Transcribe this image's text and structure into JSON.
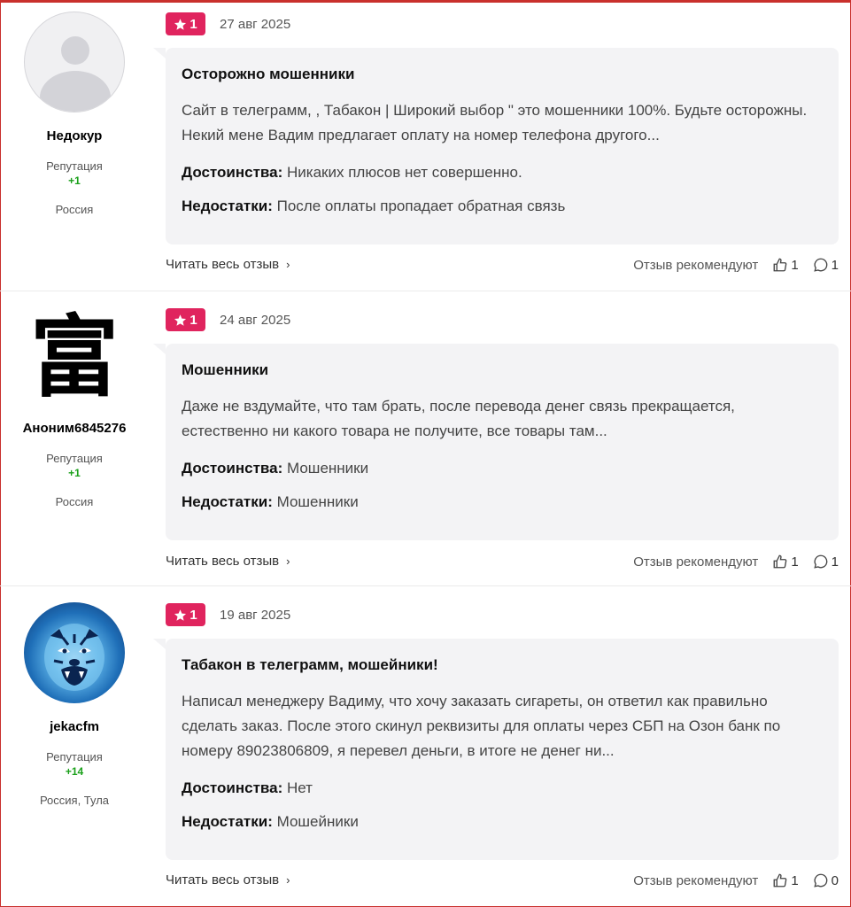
{
  "reviews": [
    {
      "user": {
        "name": "Недокур",
        "rep_label": "Репутация",
        "rep_value": "+1",
        "country": "Россия",
        "avatar": "default-avatar"
      },
      "rating": "1",
      "date": "27 авг 2025",
      "title": "Осторожно мошенники",
      "text": "Сайт в телеграмм, , Табакон | Широкий выбор \" это мошенники 100%. Будьте осторожны. Некий мене Вадим предлагает оплату на номер телефона другого...",
      "pros_label": "Достоинства:",
      "pros": "Никаких плюсов нет совершенно.",
      "cons_label": "Недостатки:",
      "cons": "После оплаты пропадает обратная связь",
      "read_more": "Читать весь отзыв",
      "recommend_label": "Отзыв рекомендуют",
      "likes": "1",
      "comments": "1"
    },
    {
      "user": {
        "name": "Аноним6845276",
        "rep_label": "Репутация",
        "rep_value": "+1",
        "country": "Россия",
        "avatar": "kanji-avatar",
        "avatar_char": "富"
      },
      "rating": "1",
      "date": "24 авг 2025",
      "title": "Мошенники",
      "text": "Даже не вздумайте, что там брать, после перевода денег связь прекращается, естественно ни какого товара не получите, все товары там...",
      "pros_label": "Достоинства:",
      "pros": "Мошенники",
      "cons_label": "Недостатки:",
      "cons": "Мошенники",
      "read_more": "Читать весь отзыв",
      "recommend_label": "Отзыв рекомендуют",
      "likes": "1",
      "comments": "1"
    },
    {
      "user": {
        "name": "jekacfm",
        "rep_label": "Репутация",
        "rep_value": "+14",
        "country": "Россия, Тула",
        "avatar": "tiger-avatar"
      },
      "rating": "1",
      "date": "19 авг 2025",
      "title": "Табакон в телеграмм, мошейники!",
      "text": "Написал менеджеру Вадиму, что хочу заказать сигареты, он ответил как правильно сделать заказ. После этого скинул реквизиты для оплаты через СБП на Озон банк по номеру 89023806809, я перевел деньги, в итоге не денег ни...",
      "pros_label": "Достоинства:",
      "pros": "Нет",
      "cons_label": "Недостатки:",
      "cons": "Мошейники",
      "read_more": "Читать весь отзыв",
      "recommend_label": "Отзыв рекомендуют",
      "likes": "1",
      "comments": "0"
    }
  ],
  "colors": {
    "badge": "#e0245e",
    "reputation": "#1aa01a",
    "card_bg": "#f3f3f5",
    "frame": "#c9302c"
  },
  "icons": {
    "star": "star-icon",
    "like": "thumbs-up-icon",
    "comment": "comment-icon",
    "chevron": "chevron-right-icon"
  }
}
